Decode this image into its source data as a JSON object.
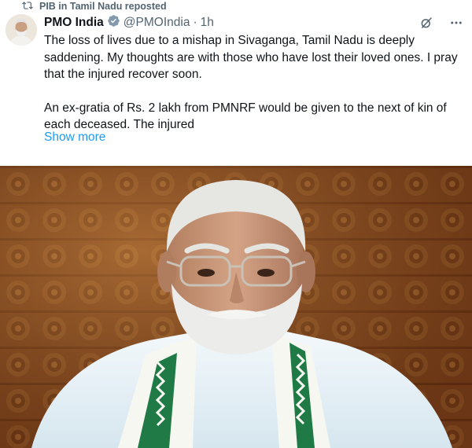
{
  "repost": {
    "label": "PIB in Tamil Nadu reposted",
    "icon": "repost-icon"
  },
  "author": {
    "name": "PMO India",
    "handle": "@PMOIndia",
    "separator": "·",
    "time": "1h"
  },
  "icons": {
    "grok": "grok-icon",
    "more": "more-icon",
    "verified": "verified-badge-icon"
  },
  "tweet": {
    "paragraphs": [
      "The loss of lives due to a mishap in Sivaganga, Tamil Nadu is deeply saddening. My thoughts are with those who have lost their loved ones. I pray that the injured recover soon.",
      "An ex-gratia of Rs. 2 lakh from PMNRF would be given to the next of kin of each deceased. The injured"
    ],
    "show_more": "Show more"
  },
  "colors": {
    "link": "#1d9bf0",
    "verified": "#829aab",
    "muted": "#536471"
  }
}
